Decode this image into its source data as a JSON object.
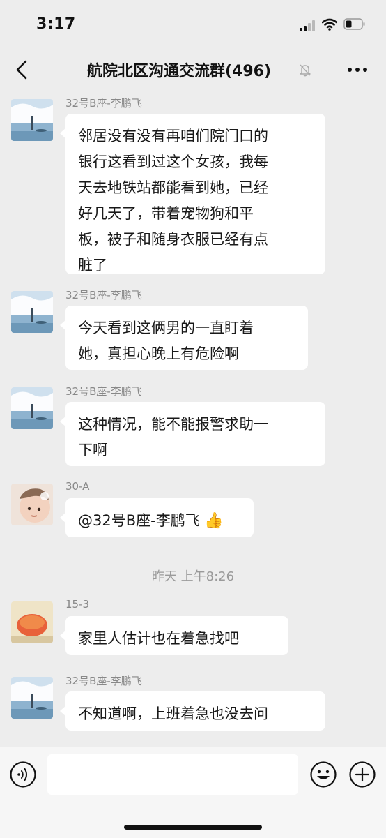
{
  "status_bar": {
    "time": "3:17"
  },
  "nav": {
    "title": "航院北区沟通交流群(496)"
  },
  "messages": [
    {
      "sender": "32号B座-李鹏飞",
      "text": "邻居没有没有再咱们院门口的\n银行这看到过这个女孩，我每\n天去地铁站都能看到她，已经\n好几天了，带着宠物狗和平\n板，被子和随身衣服已经有点\n脏了"
    },
    {
      "sender": "32号B座-李鹏飞",
      "text": "今天看到这俩男的一直盯着\n她，真担心晚上有危险啊"
    },
    {
      "sender": "32号B座-李鹏飞",
      "text": "这种情况，能不能报警求助一\n下啊"
    },
    {
      "sender": "30-A",
      "text": "@32号B座-李鹏飞 ",
      "emoji": "👍"
    },
    {
      "sender": "15-3",
      "text": "家里人估计也在着急找吧"
    },
    {
      "sender": "32号B座-李鹏飞",
      "text": "不知道啊，上班着急也没去问"
    }
  ],
  "time_separator": "昨天 上午8:26",
  "colors": {
    "background": "#ededed",
    "bubble": "#ffffff",
    "input_bar": "#f6f6f6"
  },
  "icons": [
    "back-icon",
    "mute-icon",
    "more-icon",
    "voice-icon",
    "emoji-icon",
    "plus-icon"
  ]
}
